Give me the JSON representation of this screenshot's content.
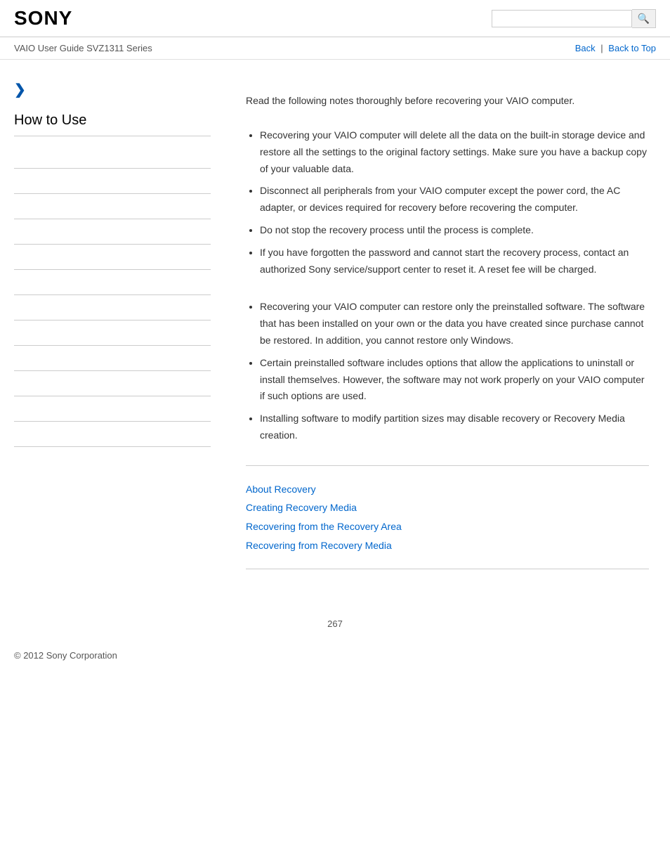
{
  "header": {
    "logo": "SONY",
    "search_placeholder": "",
    "search_icon": "🔍"
  },
  "subheader": {
    "guide_title": "VAIO User Guide SVZ1311 Series",
    "back_label": "Back",
    "separator": "|",
    "back_to_top_label": "Back to Top"
  },
  "sidebar": {
    "arrow_icon": "❯",
    "section_title": "How to Use",
    "items": [
      {
        "label": ""
      },
      {
        "label": ""
      },
      {
        "label": ""
      },
      {
        "label": ""
      },
      {
        "label": ""
      },
      {
        "label": ""
      },
      {
        "label": ""
      },
      {
        "label": ""
      },
      {
        "label": ""
      },
      {
        "label": ""
      },
      {
        "label": ""
      },
      {
        "label": ""
      }
    ]
  },
  "content": {
    "intro": "Read the following notes thoroughly before recovering your VAIO computer.",
    "section1": {
      "bullets": [
        "Recovering your VAIO computer will delete all the data on the built-in storage device and restore all the settings to the original factory settings. Make sure you have a backup copy of your valuable data.",
        "Disconnect all peripherals from your VAIO computer except the power cord, the AC adapter, or devices required for recovery before recovering the computer.",
        "Do not stop the recovery process until the process is complete.",
        "If you have forgotten the password and cannot start the recovery process, contact an authorized Sony service/support center to reset it. A reset fee will be charged."
      ]
    },
    "section2": {
      "bullets": [
        "Recovering your VAIO computer can restore only the preinstalled software. The software that has been installed on your own or the data you have created since purchase cannot be restored. In addition, you cannot restore only Windows.",
        "Certain preinstalled software includes options that allow the applications to uninstall or install themselves. However, the software may not work properly on your VAIO computer if such options are used.",
        "Installing software to modify partition sizes may disable recovery or Recovery Media creation."
      ]
    },
    "links": [
      {
        "label": "About Recovery",
        "href": "#"
      },
      {
        "label": "Creating Recovery Media",
        "href": "#"
      },
      {
        "label": "Recovering from the Recovery Area",
        "href": "#"
      },
      {
        "label": "Recovering from Recovery Media",
        "href": "#"
      }
    ]
  },
  "footer": {
    "copyright": "© 2012 Sony Corporation"
  },
  "page_number": "267"
}
